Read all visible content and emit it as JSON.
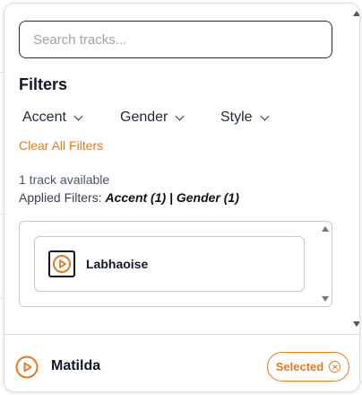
{
  "search": {
    "placeholder": "Search tracks...",
    "value": ""
  },
  "filters": {
    "title": "Filters",
    "dropdowns": [
      {
        "label": "Accent"
      },
      {
        "label": "Gender"
      },
      {
        "label": "Style"
      }
    ],
    "clear_all_label": "Clear All Filters"
  },
  "results": {
    "count_text": "1 track available",
    "applied_prefix": "Applied Filters: ",
    "applied_value": "Accent (1) | Gender (1)"
  },
  "tracks": [
    {
      "name": "Labhaoise",
      "icon": "play-icon"
    }
  ],
  "footer": {
    "name": "Matilda",
    "icon": "play-circle-icon",
    "selected_label": "Selected",
    "selected_icon": "close-circle-icon"
  },
  "colors": {
    "accent": "#e07b24",
    "text": "#111827",
    "border": "#c9c9c9"
  }
}
